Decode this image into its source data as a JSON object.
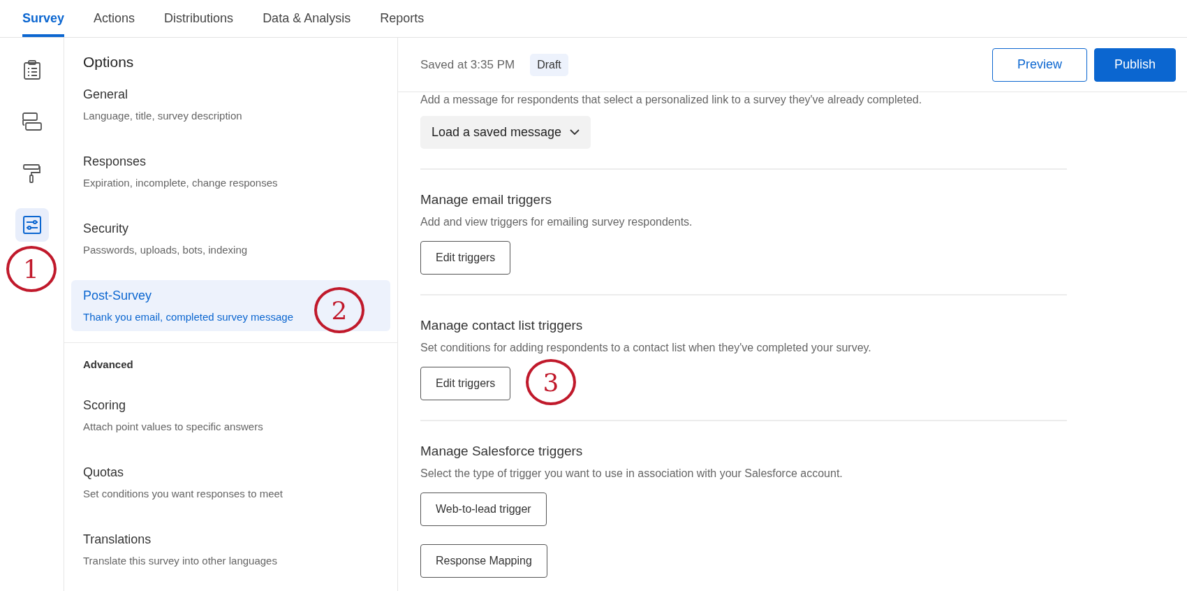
{
  "tabs": [
    {
      "label": "Survey",
      "selected": true
    },
    {
      "label": "Actions",
      "selected": false
    },
    {
      "label": "Distributions",
      "selected": false
    },
    {
      "label": "Data & Analysis",
      "selected": false
    },
    {
      "label": "Reports",
      "selected": false
    }
  ],
  "rail": [
    {
      "kind": "clipboard",
      "selected": false
    },
    {
      "kind": "blocks",
      "selected": false
    },
    {
      "kind": "roller",
      "selected": false
    },
    {
      "kind": "sliders",
      "selected": true,
      "annotation": "1"
    }
  ],
  "options": {
    "title": "Options",
    "groups": [
      {
        "items": [
          {
            "title": "General",
            "subtitle": "Language, title, survey description",
            "selected": false
          },
          {
            "title": "Responses",
            "subtitle": "Expiration, incomplete, change responses",
            "selected": false
          },
          {
            "title": "Security",
            "subtitle": "Passwords, uploads, bots, indexing",
            "selected": false
          },
          {
            "title": "Post-Survey",
            "subtitle": "Thank you email, completed survey message",
            "selected": true,
            "annotation": "2"
          }
        ]
      },
      {
        "heading": "Advanced",
        "items": [
          {
            "title": "Scoring",
            "subtitle": "Attach point values to specific answers",
            "selected": false
          },
          {
            "title": "Quotas",
            "subtitle": "Set conditions you want responses to meet",
            "selected": false
          },
          {
            "title": "Translations",
            "subtitle": "Translate this survey into other languages",
            "selected": false
          }
        ]
      }
    ]
  },
  "header": {
    "status": "Saved at 3:35 PM",
    "badge": "Draft",
    "buttons": [
      {
        "label": "Preview",
        "kind": "secondary"
      },
      {
        "label": "Publish",
        "kind": "primary"
      }
    ]
  },
  "intro": {
    "text": "Add a message for respondents that select a personalized link to a survey they've already completed.",
    "dropdown": "Load a saved message"
  },
  "sections": [
    {
      "title": "Manage email triggers",
      "description": "Add and view triggers for emailing survey respondents.",
      "buttons": [
        {
          "label": "Edit triggers"
        }
      ]
    },
    {
      "title": "Manage contact list triggers",
      "description": "Set conditions for adding respondents to a contact list when they've completed your survey.",
      "buttons": [
        {
          "label": "Edit triggers",
          "annotation": "3"
        }
      ]
    },
    {
      "title": "Manage Salesforce triggers",
      "description": "Select the type of trigger you want to use in association with your Salesforce account.",
      "buttons": [
        {
          "label": "Web-to-lead trigger"
        },
        {
          "label": "Response Mapping"
        }
      ]
    }
  ]
}
